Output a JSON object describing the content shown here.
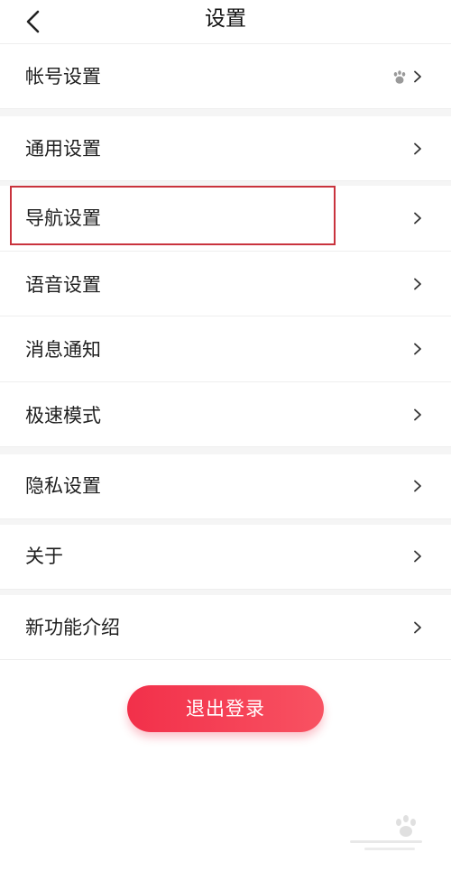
{
  "header": {
    "title": "设置"
  },
  "sections": [
    {
      "items": [
        {
          "label": "帐号设置",
          "trailing_icon": "paw-icon"
        }
      ]
    },
    {
      "items": [
        {
          "label": "通用设置"
        },
        {
          "label": "导航设置",
          "highlighted": true
        },
        {
          "label": "语音设置"
        },
        {
          "label": "消息通知"
        },
        {
          "label": "极速模式"
        }
      ]
    },
    {
      "items": [
        {
          "label": "隐私设置"
        }
      ]
    },
    {
      "items": [
        {
          "label": "关于"
        },
        {
          "label": "新功能介绍"
        }
      ]
    }
  ],
  "logout": {
    "label": "退出登录"
  },
  "colors": {
    "accent": "#f2304a",
    "highlight_border": "#c9333d",
    "divider": "#eeeeee",
    "section_gap": "#f5f5f5"
  }
}
